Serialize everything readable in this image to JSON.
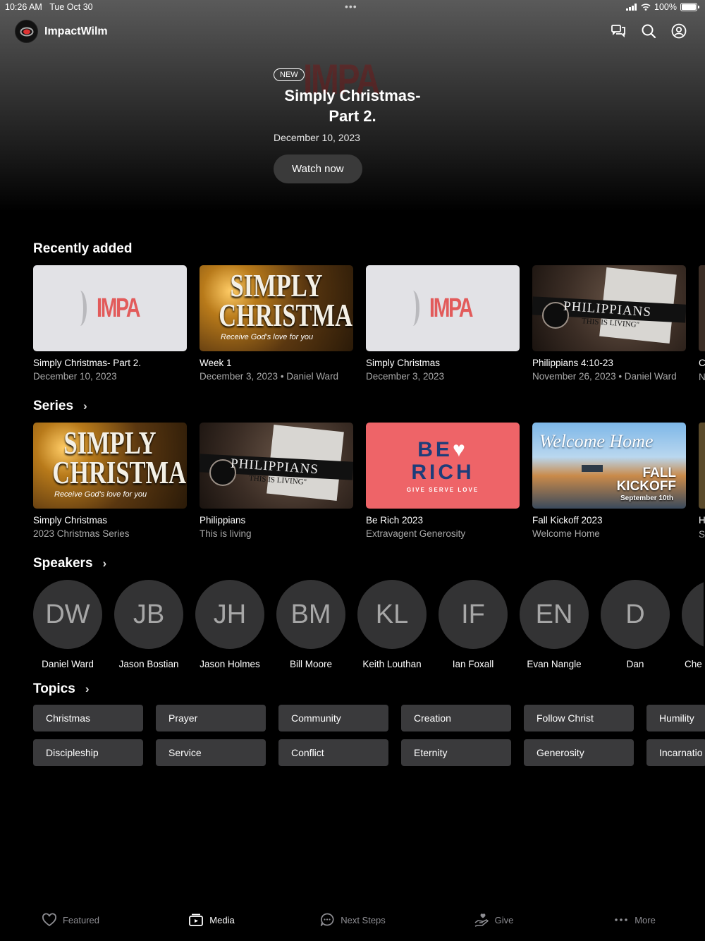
{
  "status": {
    "time": "10:26 AM",
    "date": "Tue Oct 30",
    "battery": "100%"
  },
  "app": {
    "name": "ImpactWilm"
  },
  "hero": {
    "badge": "NEW",
    "watermark": "IMPA",
    "title": "Simply Christmas- Part 2.",
    "date": "December 10, 2023",
    "button": "Watch now"
  },
  "recently_added": {
    "title": "Recently added",
    "items": [
      {
        "title": "Simply Christmas- Part 2.",
        "subtitle": "December 10, 2023",
        "thumb": "impact-logo"
      },
      {
        "title": "Week 1",
        "subtitle": "December 3, 2023 • Daniel Ward",
        "thumb": "simply-christmas"
      },
      {
        "title": "Simply Christmas",
        "subtitle": "December 3, 2023",
        "thumb": "impact-logo"
      },
      {
        "title": "Philippians 4:10-23",
        "subtitle": "November 26, 2023 • Daniel Ward",
        "thumb": "philippians"
      }
    ],
    "peek": {
      "title": "C",
      "subtitle": "N"
    }
  },
  "thumb_text": {
    "impact": "IMPA",
    "christmas_line1": "SIMPLY",
    "christmas_line2": "CHRISTMAS",
    "christmas_sub": "Receive God's love for you",
    "phil_word": "PHILIPPIANS",
    "phil_sub": "THIS IS LIVING\"",
    "berich_line1": "BE",
    "berich_line2": "RICH",
    "berich_tag": "GIVE SERVE LOVE",
    "fall_welcome": "Welcome Home",
    "fall_line1": "FALL",
    "fall_line2": "KICKOFF",
    "fall_date": "September 10th"
  },
  "series": {
    "title": "Series",
    "items": [
      {
        "title": "Simply Christmas",
        "subtitle": "2023 Christmas Series"
      },
      {
        "title": "Philippians",
        "subtitle": "This is living"
      },
      {
        "title": "Be Rich 2023",
        "subtitle": "Extravagent Generosity"
      },
      {
        "title": "Fall Kickoff 2023",
        "subtitle": "Welcome Home"
      }
    ],
    "peek": {
      "title": "H",
      "subtitle": "S"
    }
  },
  "speakers": {
    "title": "Speakers",
    "items": [
      {
        "initials": "DW",
        "name": "Daniel Ward"
      },
      {
        "initials": "JB",
        "name": "Jason Bostian"
      },
      {
        "initials": "JH",
        "name": "Jason Holmes"
      },
      {
        "initials": "BM",
        "name": "Bill Moore"
      },
      {
        "initials": "KL",
        "name": "Keith Louthan"
      },
      {
        "initials": "IF",
        "name": "Ian Foxall"
      },
      {
        "initials": "EN",
        "name": "Evan Nangle"
      },
      {
        "initials": "D",
        "name": "Dan"
      },
      {
        "initials": "C",
        "name": "Che"
      }
    ]
  },
  "topics": {
    "title": "Topics",
    "items": [
      "Christmas",
      "Prayer",
      "Community",
      "Creation",
      "Follow Christ",
      "Humility",
      "Discipleship",
      "Service",
      "Conflict",
      "Eternity",
      "Generosity",
      "Incarnatio"
    ]
  },
  "tabs": [
    {
      "label": "Featured",
      "icon": "heart-icon"
    },
    {
      "label": "Media",
      "icon": "media-icon",
      "active": true
    },
    {
      "label": "Next Steps",
      "icon": "chat-bubble-icon"
    },
    {
      "label": "Give",
      "icon": "give-hand-icon"
    },
    {
      "label": "More",
      "icon": "more-dots-icon"
    }
  ],
  "colors": {
    "background": "#000000",
    "chip": "#3a3a3c",
    "avatar": "#333334",
    "brand_red": "#e25b5b",
    "berich": "#ee6468"
  }
}
